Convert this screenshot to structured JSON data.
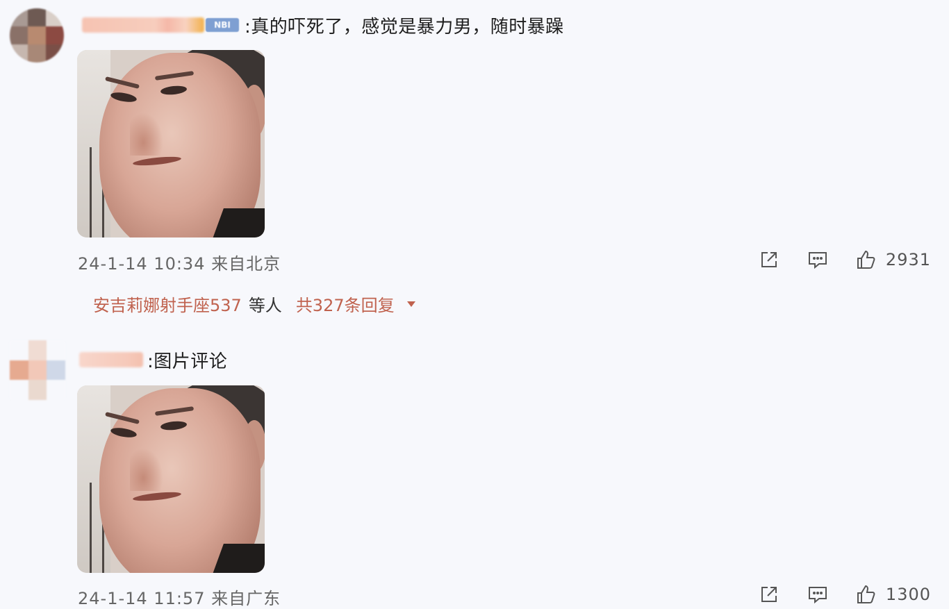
{
  "comments": [
    {
      "badge": "NBI",
      "text": ":真的吓死了，感觉是暴力男，随时暴躁",
      "timestamp": "24-1-14 10:34",
      "location": "来自北京",
      "likes": "2931",
      "avatar_colors": [
        "#a99a94",
        "#6e5a53",
        "#d9cfc8",
        "#8a7168",
        "#b88a70",
        "#8c4a42",
        "#c6b7af",
        "#a88877",
        "#7a4f47"
      ],
      "replies": {
        "user": "安吉莉娜射手座537",
        "etc": "等人",
        "total": "共327条回复"
      }
    },
    {
      "text": ":图片评论",
      "timestamp": "24-1-14 11:57",
      "location": "来自广东",
      "likes": "1300",
      "avatar_colors": [
        "#f7f8fc",
        "#f0dcd3",
        "#f7f8fc",
        "#e6aa90",
        "#f2c8b8",
        "#cfd8e8",
        "#f7f8fc",
        "#ead9cf",
        "#f7f8fc"
      ]
    }
  ],
  "icons": {
    "share": "share-icon",
    "comment": "comment-icon",
    "like": "thumbs-up-icon",
    "expand": "caret-down-icon"
  },
  "colors": {
    "background": "#f7f8fc",
    "reply_accent": "#c0624e",
    "badge": "#7e9fd2"
  }
}
